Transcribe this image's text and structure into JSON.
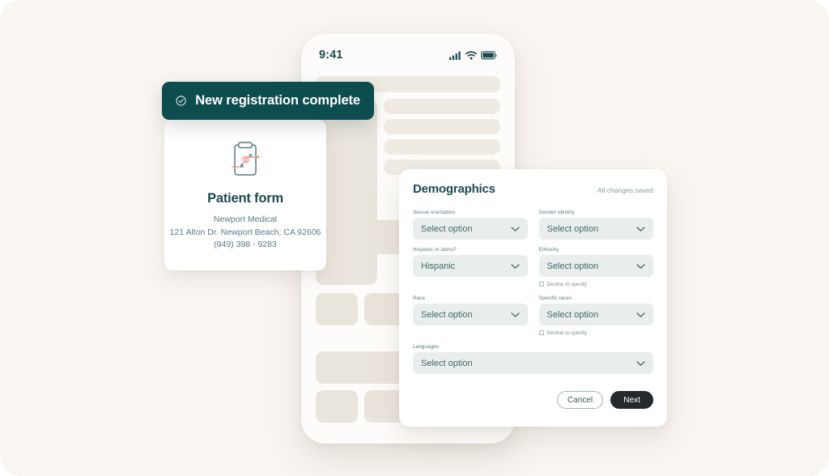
{
  "background_color": "#f9f5f0",
  "phone": {
    "status_bar": {
      "time": "9:41",
      "icons": [
        "signal-icon",
        "wifi-icon",
        "battery-icon"
      ]
    }
  },
  "toast": {
    "icon": "check-circle-icon",
    "message": "New registration complete",
    "background_color": "#0d4d4f",
    "text_color": "#ffffff"
  },
  "patient_card": {
    "icon": "clipboard-form-icon",
    "title": "Patient form",
    "organization": "Newport Medical",
    "address": "121 Alton Dr. Newport Beach, CA 92606",
    "phone": "(949) 398 - 9283"
  },
  "panel": {
    "title": "Demographics",
    "saved_status": "All changes saved",
    "fields": [
      {
        "label": "Sexual orientation",
        "value": "Select option",
        "decline": null
      },
      {
        "label": "Gender identity",
        "value": "Select option",
        "decline": null
      },
      {
        "label": "Hispanic or latino?",
        "value": "Hispanic",
        "decline": null
      },
      {
        "label": "Ethnicity",
        "value": "Select option",
        "decline": "Decline to specify"
      },
      {
        "label": "Race",
        "value": "Select option",
        "decline": null
      },
      {
        "label": "Specific races",
        "value": "Select option",
        "decline": "Decline to specify"
      },
      {
        "label": "Languages",
        "value": "Select option",
        "decline": null
      }
    ],
    "actions": {
      "cancel_label": "Cancel",
      "next_label": "Next",
      "next_color": "#26292b"
    }
  }
}
